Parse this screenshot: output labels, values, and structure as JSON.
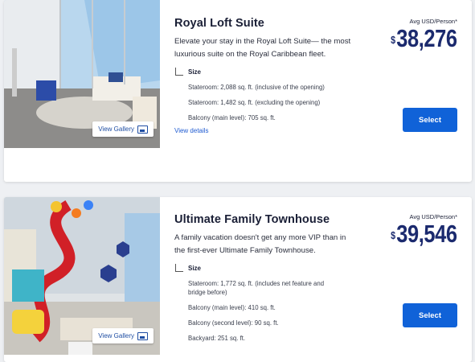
{
  "suites": [
    {
      "name": "Royal Loft Suite",
      "description": "Elevate your stay in the Royal Loft Suite— the most luxurious suite on the Royal Caribbean fleet.",
      "gallery_label": "View Gallery",
      "size_label": "Size",
      "specs": [
        "Stateroom: 2,088 sq. ft. (inclusive of the opening)",
        "Stateroom: 1,482 sq. ft. (excluding the opening)",
        "Balcony (main level): 705 sq. ft."
      ],
      "view_details": "View details",
      "avg_label": "Avg USD/Person*",
      "currency": "$",
      "price": "38,276",
      "select_label": "Select"
    },
    {
      "name": "Ultimate Family Townhouse",
      "description": "A family vacation doesn't get any more VIP than in the first-ever Ultimate Family Townhouse.",
      "gallery_label": "View Gallery",
      "size_label": "Size",
      "specs": [
        "Stateroom: 1,772 sq. ft. (includes net feature and bridge before)",
        "Balcony (main level): 410 sq. ft.",
        "Balcony (second level): 90 sq. ft.",
        "Backyard: 251 sq. ft."
      ],
      "avg_label": "Avg USD/Person*",
      "currency": "$",
      "price": "39,546",
      "select_label": "Select"
    }
  ],
  "colors": {
    "accent_button": "#1062d8",
    "price": "#1b2a6e",
    "link": "#1f5bd1"
  }
}
